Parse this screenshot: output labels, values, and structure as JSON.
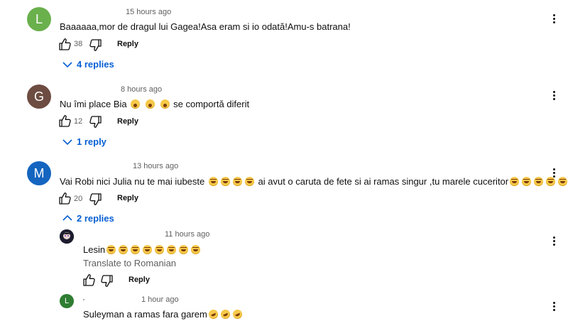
{
  "comments": [
    {
      "avatar_letter": "L",
      "avatar_color": "#6ab04c",
      "time": "15 hours ago",
      "text": "Baaaaaa,mor de dragul lui Gagea!Asa eram si io odată!Amu-s batrana!",
      "likes": "38",
      "reply_label": "Reply",
      "replies_label": "4 replies"
    },
    {
      "avatar_letter": "G",
      "avatar_color": "#6d4c41",
      "time": "8 hours ago",
      "text_before": "Nu îmi place Bia",
      "emojis": [
        "astonished-face",
        "astonished-face",
        "astonished-face"
      ],
      "text_after": " se comportă diferit",
      "likes": "12",
      "reply_label": "Reply",
      "replies_label": "1 reply"
    },
    {
      "avatar_letter": "M",
      "avatar_color": "#1565c0",
      "time": "13 hours ago",
      "text_a": "Vai Robi nici Julia nu te mai iubeste",
      "text_b": " ai avut o caruta de fete si ai ramas singur ,tu marele cuceritor",
      "likes": "20",
      "reply_label": "Reply",
      "replies_label": "2 replies"
    }
  ],
  "replies": [
    {
      "time": "11 hours ago",
      "text": "Lesin",
      "translate_label": "Translate to Romanian",
      "reply_label": "Reply"
    },
    {
      "avatar_letter": "L",
      "avatar_color": "#2e7d32",
      "time": "1 hour ago",
      "text": "Suleyman a ramas fara garem"
    }
  ],
  "colors": {
    "link_blue": "#065fd4",
    "meta_gray": "#606060"
  }
}
